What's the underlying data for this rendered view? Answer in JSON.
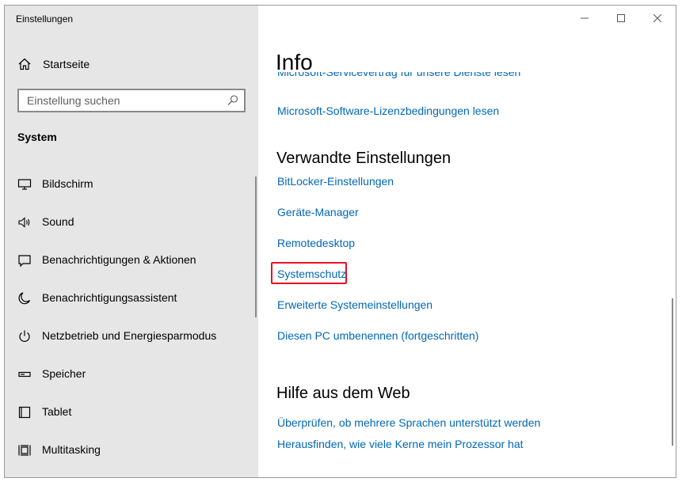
{
  "window": {
    "title": "Einstellungen"
  },
  "sidebar": {
    "home": {
      "label": "Startseite",
      "icon": "home-icon"
    },
    "search": {
      "placeholder": "Einstellung suchen",
      "icon": "search-icon"
    },
    "section": "System",
    "items": [
      {
        "label": "Bildschirm",
        "icon": "monitor-icon"
      },
      {
        "label": "Sound",
        "icon": "speaker-icon"
      },
      {
        "label": "Benachrichtigungen & Aktionen",
        "icon": "message-icon"
      },
      {
        "label": "Benachrichtigungsassistent",
        "icon": "moon-icon"
      },
      {
        "label": "Netzbetrieb und Energiesparmodus",
        "icon": "power-icon"
      },
      {
        "label": "Speicher",
        "icon": "storage-icon"
      },
      {
        "label": "Tablet",
        "icon": "tablet-icon"
      },
      {
        "label": "Multitasking",
        "icon": "multitasking-icon"
      }
    ]
  },
  "content": {
    "title": "Info",
    "clipped_link": "Microsoft-Servicevertrag für unsere Dienste lesen",
    "license_link": "Microsoft-Software-Lizenzbedingungen lesen",
    "related": {
      "heading": "Verwandte Einstellungen",
      "links": [
        "BitLocker-Einstellungen",
        "Geräte-Manager",
        "Remotedesktop",
        "Systemschutz",
        "Erweiterte Systemeinstellungen",
        "Diesen PC umbenennen (fortgeschritten)"
      ]
    },
    "help": {
      "heading": "Hilfe aus dem Web",
      "links": [
        "Überprüfen, ob mehrere Sprachen unterstützt werden",
        "Herausfinden, wie viele Kerne mein Prozessor hat"
      ]
    }
  },
  "colors": {
    "link": "#0067b8",
    "sidebar_bg": "#e6e6e6",
    "highlight": "#e81123"
  }
}
